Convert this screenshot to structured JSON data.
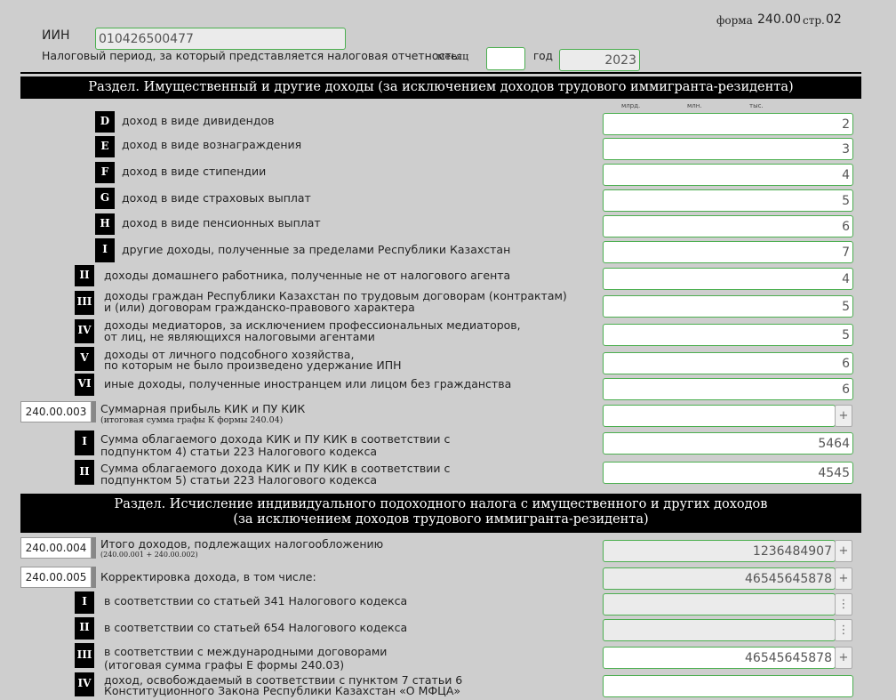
{
  "header": {
    "form_label": "форма",
    "form_number": "240.00",
    "page_label": "стр.",
    "page_number": "02",
    "iin_label": "ИИН",
    "iin_value": "010426500477",
    "period_label": "Налоговый период, за который представляется налоговая отчетность:",
    "month_label": "месяц",
    "month_value": "",
    "year_label": "год",
    "year_value": "2023"
  },
  "section1": {
    "title": "Раздел. Имущественный и другие доходы (за исключением доходов трудового иммигранта-резидента)",
    "units": [
      "млрд.",
      "млн.",
      "тыс."
    ],
    "rows_letter": [
      {
        "badge": "D",
        "label": "доход в виде дивидендов",
        "value": "2"
      },
      {
        "badge": "E",
        "label": "доход в виде вознаграждения",
        "value": "3"
      },
      {
        "badge": "F",
        "label": "доход в виде стипендии",
        "value": "4"
      },
      {
        "badge": "G",
        "label": "доход в виде страховых выплат",
        "value": "5"
      },
      {
        "badge": "H",
        "label": "доход в виде пенсионных выплат",
        "value": "6"
      },
      {
        "badge": "I",
        "label": "другие доходы, полученные за пределами Республики Казахстан",
        "value": "7"
      }
    ],
    "rows_roman": [
      {
        "badge": "II",
        "line1": "доходы домашнего работника, полученные не от налогового агента",
        "line2": "",
        "value": "4"
      },
      {
        "badge": "III",
        "line1": "доходы граждан Республики Казахстан по трудовым договорам (контрактам)",
        "line2": "и (или) договорам гражданско-правового характера",
        "value": "5"
      },
      {
        "badge": "IV",
        "line1": "доходы медиаторов, за исключением профессиональных медиаторов,",
        "line2": "от лиц, не являющихся налоговыми агентами",
        "value": "5"
      },
      {
        "badge": "V",
        "line1": "доходы от личного подсобного хозяйства,",
        "line2": "по которым не было произведено удержание ИПН",
        "value": "6"
      },
      {
        "badge": "VI",
        "line1": "иные доходы, полученные иностранцем или лицом без гражданства",
        "line2": "",
        "value": "6"
      }
    ],
    "kik": {
      "code": "240.00.003",
      "label": "Суммарная прибыль КИК и ПУ КИК",
      "sublabel": "(итоговая сумма графы К формы 240.04)",
      "value": "",
      "button": "+"
    },
    "kik_rows": [
      {
        "badge": "I",
        "line1": "Сумма облагаемого дохода КИК и ПУ КИК в соответствии с",
        "line2": "подпунктом 4) статьи 223 Налогового кодекса",
        "value": "5464"
      },
      {
        "badge": "II",
        "line1": "Сумма облагаемого дохода КИК и ПУ КИК в соответствии с",
        "line2": "подпунктом 5) статьи 223 Налогового кодекса",
        "value": "4545"
      }
    ]
  },
  "section2": {
    "title_line1": "Раздел. Исчисление индивидуального подоходного налога с имущественного и других доходов",
    "title_line2": "(за исключением доходов трудового иммигранта-резидента)",
    "total": {
      "code": "240.00.004",
      "label": "Итого доходов, подлежащих налогообложению",
      "sublabel": "(240.00.001 + 240.00.002)",
      "value": "1236484907",
      "button": "+"
    },
    "adjust": {
      "code": "240.00.005",
      "label": "Корректировка дохода, в том числе:",
      "value": "46545645878",
      "button": "+"
    },
    "adjust_rows": [
      {
        "badge": "I",
        "line1": "в соответствии со статьей 341 Налогового кодекса",
        "line2": "",
        "value": "",
        "button": "⋮"
      },
      {
        "badge": "II",
        "line1": "в соответствии со статьей 654 Налогового кодекса",
        "line2": "",
        "value": "",
        "button": "⋮"
      },
      {
        "badge": "III",
        "line1": "в соответствии с международными договорами",
        "line2": "(итоговая сумма графы Е формы 240.03)",
        "value": "46545645878",
        "button": "+"
      },
      {
        "badge": "IV",
        "line1": "доход, освобождаемый в соответствии с пунктом 7 статьи 6",
        "line2": "Конституционного Закона Республики Казахстан «О МФЦА»",
        "value": ""
      }
    ]
  }
}
